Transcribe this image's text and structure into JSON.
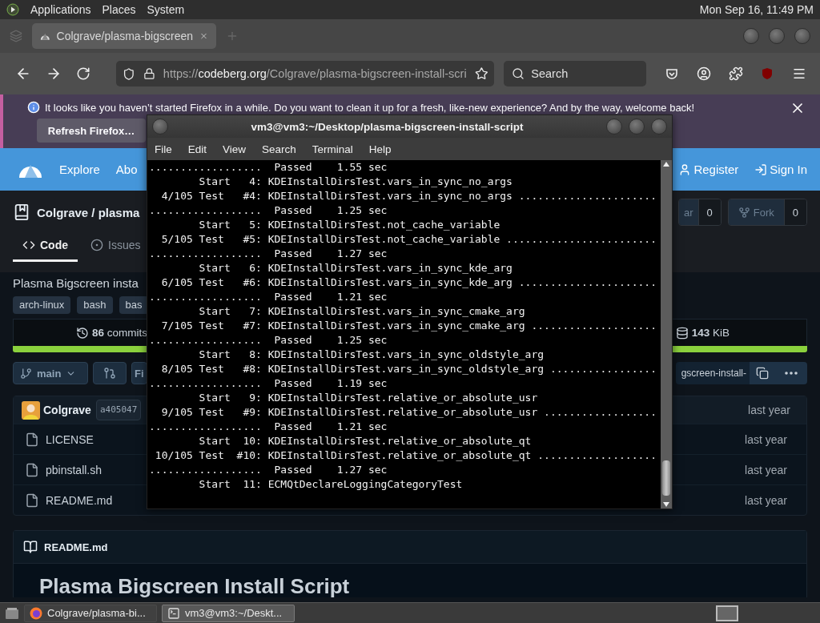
{
  "top_panel": {
    "menus": [
      "Applications",
      "Places",
      "System"
    ],
    "clock": "Mon Sep 16, 11:49 PM"
  },
  "browser": {
    "tabs": [
      {
        "title": "Colgrave/plasma-bigscreen",
        "selected": true
      }
    ],
    "url": {
      "scheme": "https://",
      "host": "codeberg.org",
      "path": "/Colgrave/plasma-bigscreen-install-scri"
    },
    "search": {
      "placeholder": "Search"
    },
    "notification": {
      "message": "It looks like you haven’t started Firefox in a while. Do you want to clean it up for a fresh, like-new experience? And by the way, welcome back!",
      "button": "Refresh Firefox…"
    }
  },
  "page": {
    "nav": {
      "links": [
        "Explore",
        "Abo"
      ],
      "register": "Register",
      "sign_in": "Sign In"
    },
    "repo": {
      "title": "Colgrave / plasma",
      "star": {
        "label": "ar",
        "count": "0"
      },
      "fork": {
        "label": "Fork",
        "count": "0"
      }
    },
    "tabs": [
      {
        "label": "Code",
        "selected": true
      },
      {
        "label": "Issues",
        "selected": false
      }
    ],
    "description": "Plasma Bigscreen insta",
    "topics": [
      "arch-linux",
      "bash",
      "bas"
    ],
    "stats": {
      "commits": "**86** commits",
      "size": "**143** KiB"
    },
    "branch": "main",
    "filter_button": "Fi",
    "clone_url": "gscreen-install-",
    "latest_commit": {
      "author": "Colgrave",
      "sha": "a405047",
      "time": "last year"
    },
    "files": [
      {
        "name": "LICENSE",
        "time": "last year"
      },
      {
        "name": "pbinstall.sh",
        "time": "last year"
      },
      {
        "name": "README.md",
        "time": "last year"
      }
    ],
    "readme": {
      "title": "README.md",
      "heading": "Plasma Bigscreen Install Script"
    }
  },
  "terminal": {
    "title": "vm3@vm3:~/Desktop/plasma-bigscreen-install-script",
    "menus": [
      "File",
      "Edit",
      "View",
      "Search",
      "Terminal",
      "Help"
    ],
    "lines": [
      "..................  Passed    1.55 sec",
      "        Start   4: KDEInstallDirsTest.vars_in_sync_no_args",
      "  4/105 Test   #4: KDEInstallDirsTest.vars_in_sync_no_args ......................",
      "..................  Passed    1.25 sec",
      "        Start   5: KDEInstallDirsTest.not_cache_variable",
      "  5/105 Test   #5: KDEInstallDirsTest.not_cache_variable ........................",
      "..................  Passed    1.27 sec",
      "        Start   6: KDEInstallDirsTest.vars_in_sync_kde_arg",
      "  6/105 Test   #6: KDEInstallDirsTest.vars_in_sync_kde_arg ......................",
      "..................  Passed    1.21 sec",
      "        Start   7: KDEInstallDirsTest.vars_in_sync_cmake_arg",
      "  7/105 Test   #7: KDEInstallDirsTest.vars_in_sync_cmake_arg ....................",
      "..................  Passed    1.25 sec",
      "        Start   8: KDEInstallDirsTest.vars_in_sync_oldstyle_arg",
      "  8/105 Test   #8: KDEInstallDirsTest.vars_in_sync_oldstyle_arg .................",
      "..................  Passed    1.19 sec",
      "        Start   9: KDEInstallDirsTest.relative_or_absolute_usr",
      "  9/105 Test   #9: KDEInstallDirsTest.relative_or_absolute_usr ..................",
      "..................  Passed    1.21 sec",
      "        Start  10: KDEInstallDirsTest.relative_or_absolute_qt",
      " 10/105 Test  #10: KDEInstallDirsTest.relative_or_absolute_qt ...................",
      "..................  Passed    1.27 sec",
      "        Start  11: ECMQtDeclareLoggingCategoryTest"
    ]
  },
  "taskbar": {
    "tasks": [
      {
        "kind": "browser",
        "label": "Colgrave/plasma-bi...",
        "selected": false
      },
      {
        "kind": "terminal",
        "label": "vm3@vm3:~/Deskt...",
        "selected": true
      }
    ]
  }
}
